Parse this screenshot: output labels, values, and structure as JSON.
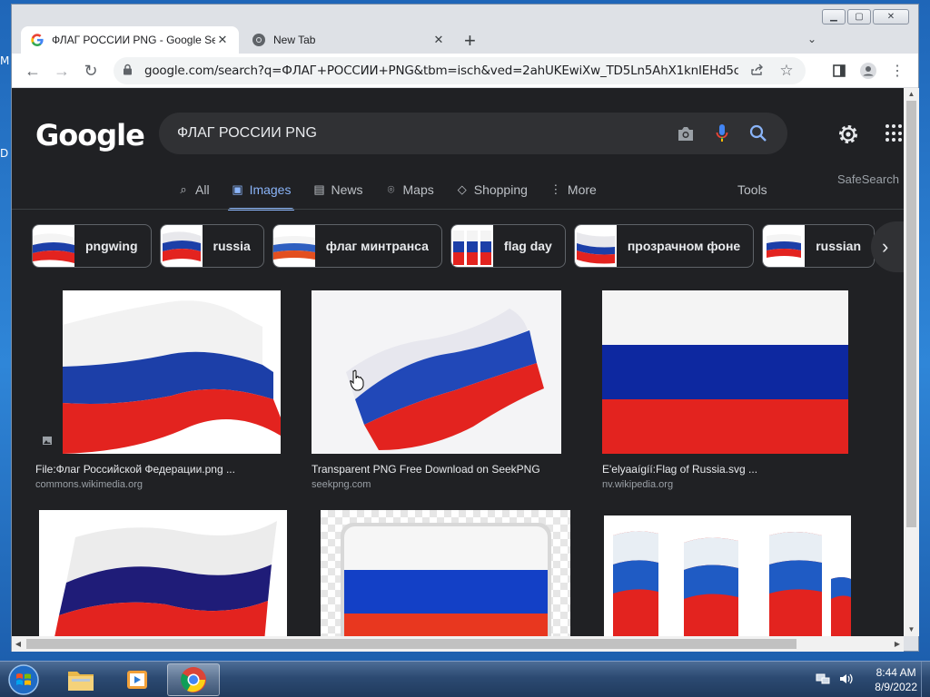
{
  "desktop": {
    "letters": [
      "M",
      "D"
    ]
  },
  "window": {
    "minimize_glyph": "▁",
    "maximize_glyph": "▢",
    "close_glyph": "✕"
  },
  "tabs": [
    {
      "title": "ФЛАГ РОССИИ PNG - Google Se",
      "icon": "google-favicon",
      "active": true
    },
    {
      "title": "New Tab",
      "icon": "chrome-favicon",
      "active": false
    }
  ],
  "toolbar": {
    "back_glyph": "←",
    "forward_glyph": "→",
    "reload_glyph": "↻",
    "url": "google.com/search?q=ФЛАГ+РОССИИ+PNG&tbm=isch&ved=2ahUKEwiXw_TD5Ln5AhX1knIEHd5cArcQ2-c...",
    "lock_icon": "lock-icon",
    "share_icon": "share-icon",
    "star_glyph": "☆",
    "menu_glyph": "⋮"
  },
  "google": {
    "logo": "Google",
    "query": "ФЛАГ РОССИИ PNG",
    "nav_tabs": [
      {
        "label": "All",
        "icon": "search-icon",
        "glyph": "⌕",
        "active": false
      },
      {
        "label": "Images",
        "icon": "image-icon",
        "glyph": "▣",
        "active": true
      },
      {
        "label": "News",
        "icon": "news-icon",
        "glyph": "▤",
        "active": false
      },
      {
        "label": "Maps",
        "icon": "map-pin-icon",
        "glyph": "⌾",
        "active": false
      },
      {
        "label": "Shopping",
        "icon": "tag-icon",
        "glyph": "◇",
        "active": false
      },
      {
        "label": "More",
        "icon": "more-vert-icon",
        "glyph": "⋮",
        "active": false
      }
    ],
    "tools_label": "Tools",
    "safesearch_label": "SafeSearch",
    "chips": [
      "pngwing",
      "russia",
      "флаг минтранса",
      "flag day",
      "прозрачном фоне",
      "russian"
    ],
    "chip_next_glyph": "›",
    "results": [
      {
        "caption": "File:Флаг Российской Федерации.png ...",
        "source": "commons.wikimedia.org"
      },
      {
        "caption": "Transparent PNG Free Download on SeekPNG",
        "source": "seekpng.com"
      },
      {
        "caption": "E'elyaaígíí:Flag of Russia.svg ...",
        "source": "nv.wikipedia.org"
      },
      {
        "caption": "",
        "source": ""
      },
      {
        "caption": "",
        "source": ""
      },
      {
        "caption": "",
        "source": ""
      }
    ]
  },
  "colors": {
    "flag_white": "#f4f4f4",
    "flag_blue": "#1c3fa8",
    "flag_red": "#e3231f",
    "link_blue": "#8ab4f8",
    "page_bg": "#202124"
  },
  "taskbar": {
    "items": [
      "start-orb",
      "file-explorer",
      "media-player",
      "chrome"
    ],
    "time": "8:44 AM",
    "date": "8/9/2022"
  }
}
